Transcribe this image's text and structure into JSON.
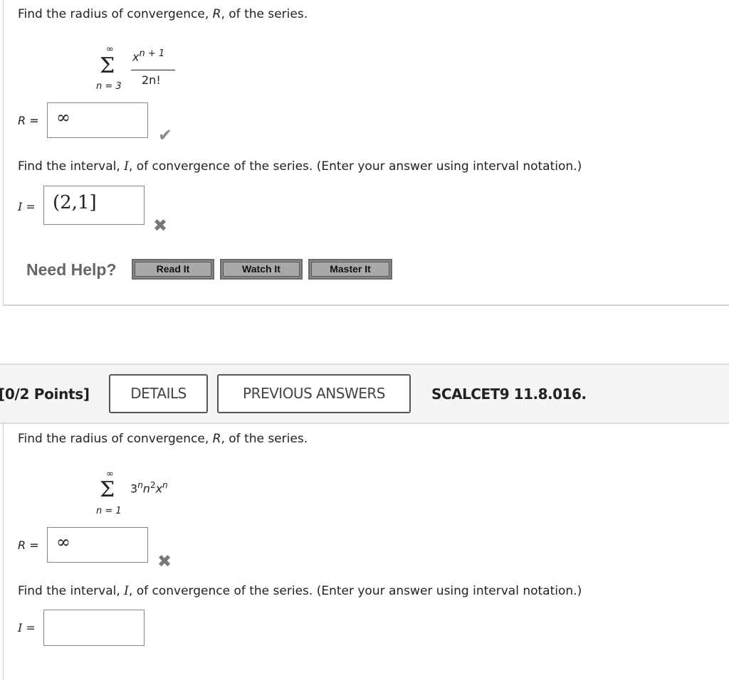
{
  "q1": {
    "prompt_radius": [
      "Find the radius of convergence, ",
      "R",
      ", of the series."
    ],
    "series": {
      "upper": "∞",
      "sigma": "Σ",
      "lower": "n = 3",
      "numerator_base": "x",
      "numerator_exp": "n + 1",
      "denominator": "2n!"
    },
    "radius_label": "R =",
    "radius_value": "∞",
    "radius_status": "correct",
    "radius_status_icon": "✔",
    "prompt_interval": [
      "Find the interval, ",
      "I",
      ", of convergence of the series. (Enter your answer using interval notation.)"
    ],
    "interval_label": "I =",
    "interval_value": "(2,1]",
    "interval_status": "incorrect",
    "interval_status_icon": "✖",
    "need_help": "Need Help?",
    "help_buttons": [
      "Read It",
      "Watch It",
      "Master It"
    ]
  },
  "header": {
    "points": "[0/2 Points]",
    "details_label": "DETAILS",
    "previous_answers_label": "PREVIOUS ANSWERS",
    "problem_code": "SCALCET9 11.8.016."
  },
  "q2": {
    "prompt_radius": [
      "Find the radius of convergence, ",
      "R",
      ", of the series."
    ],
    "series": {
      "upper": "∞",
      "sigma": "Σ",
      "lower": "n = 1",
      "term": [
        "3",
        "n",
        "n",
        "2",
        "x",
        "n"
      ]
    },
    "radius_label": "R =",
    "radius_value": "∞",
    "radius_status": "incorrect",
    "radius_status_icon": "✖",
    "prompt_interval": [
      "Find the interval, ",
      "I",
      ", of convergence of the series. (Enter your answer using interval notation.)"
    ],
    "interval_label": "I =",
    "interval_value": ""
  }
}
